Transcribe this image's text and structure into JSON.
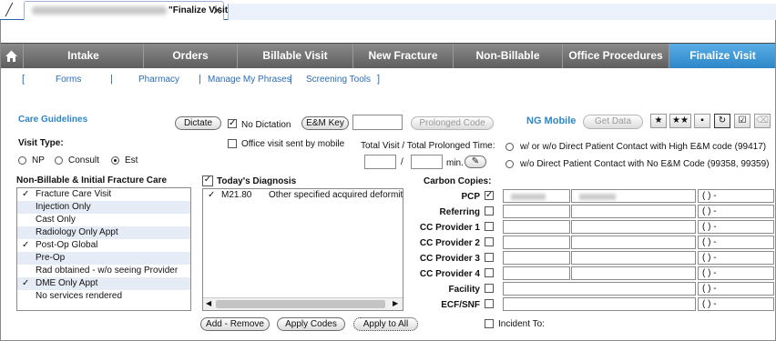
{
  "window": {
    "doc_tab_title": "\"Finalize Visit\"",
    "close_glyph": "✕"
  },
  "nav": {
    "tabs": [
      {
        "label": "Intake"
      },
      {
        "label": "Orders"
      },
      {
        "label": "Billable Visit"
      },
      {
        "label": "New Fracture"
      },
      {
        "label": "Non-Billable"
      },
      {
        "label": "Office Procedures"
      },
      {
        "label": "Finalize Visit"
      }
    ],
    "active_tab": "Finalize Visit"
  },
  "sublinks": {
    "forms": "Forms",
    "pharmacy": "Pharmacy",
    "manage_phrases": "Manage My Phrases",
    "screening": "Screening Tools"
  },
  "toolbar": {
    "care_guidelines": "Care Guidelines",
    "dictate": "Dictate",
    "no_dictation": "No Dictation",
    "em_key": "E&M Key",
    "prolonged_code": "Prolonged Code",
    "ng_mobile": "NG Mobile",
    "get_data": "Get Data",
    "office_visit_mobile": "Office visit sent by mobile",
    "total_visit": "Total Visit / Total Prolonged Time:",
    "slash": "/",
    "min": "min."
  },
  "visit_type": {
    "label": "Visit Type:",
    "options": [
      "NP",
      "Consult",
      "Est"
    ],
    "selected": "Est"
  },
  "nonbillable": {
    "title": "Non-Billable & Initial Fracture Care",
    "items": [
      {
        "label": "Fracture Care Visit",
        "checked": true
      },
      {
        "label": "Injection Only",
        "checked": false
      },
      {
        "label": "Cast Only",
        "checked": false
      },
      {
        "label": "Radiology Only Appt",
        "checked": false
      },
      {
        "label": "Post-Op Global",
        "checked": true
      },
      {
        "label": "Pre-Op",
        "checked": false
      },
      {
        "label": "Rad obtained - w/o seeing Provider",
        "checked": false
      },
      {
        "label": "DME Only Appt",
        "checked": true
      },
      {
        "label": "No services rendered",
        "checked": false
      }
    ]
  },
  "diagnosis": {
    "title": "Today's Diagnosis",
    "rows": [
      {
        "code": "M21.80",
        "desc": "Other specified acquired deformities"
      }
    ],
    "add_remove": "Add - Remove",
    "apply_codes": "Apply Codes",
    "apply_all": "Apply to All"
  },
  "contact": {
    "opt1": "w/ or w/o Direct Patient Contact with High E&M code (99417)",
    "opt2": "w/o Direct Patient Contact with No E&M Code (99358, 99359)"
  },
  "carbon": {
    "title": "Carbon Copies:",
    "rows": [
      {
        "label": "PCP",
        "checked": true,
        "phone": "(   )    -"
      },
      {
        "label": "Referring",
        "checked": false,
        "phone": "(   )    -"
      },
      {
        "label": "CC Provider 1",
        "checked": false,
        "phone": "(   )    -"
      },
      {
        "label": "CC Provider 2",
        "checked": false,
        "phone": "(   )    -"
      },
      {
        "label": "CC Provider 3",
        "checked": false,
        "phone": "(   )    -"
      },
      {
        "label": "CC Provider 4",
        "checked": false,
        "phone": "(   )    -"
      },
      {
        "label": "Facility",
        "checked": false,
        "phone": "(   )    -"
      },
      {
        "label": "ECF/SNF",
        "checked": false,
        "phone": "(   )    -"
      }
    ],
    "incident_to": "Incident To:"
  },
  "glyphs": {
    "check": "✓",
    "scroll_left": "◀",
    "scroll_right": "▶"
  },
  "colors": {
    "accent_blue": "#2d86c8",
    "link_blue": "#2a6cb5",
    "nav_gray": "#6d6d6d"
  }
}
